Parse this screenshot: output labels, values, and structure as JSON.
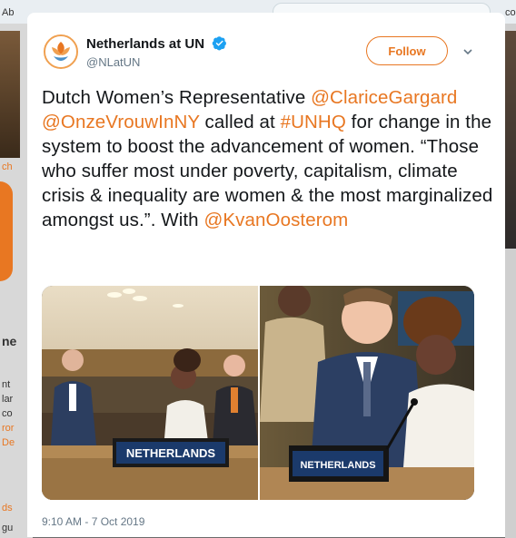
{
  "background": {
    "search_text": "",
    "side_text": [
      "Ab",
      "co",
      "ch",
      "ne",
      "nt",
      "lar",
      "co",
      "ror",
      "De",
      "ds",
      "gu"
    ]
  },
  "tweet": {
    "display_name": "Netherlands at UN",
    "handle": "@NLatUN",
    "follow_label": "Follow",
    "text_parts": [
      {
        "text": "Dutch Women’s Representative ",
        "link": false
      },
      {
        "text": "@ClariceGargard",
        "link": true
      },
      {
        "text": " ",
        "link": false
      },
      {
        "text": "@OnzeVrouwInNY",
        "link": true
      },
      {
        "text": " called at ",
        "link": false
      },
      {
        "text": "#UNHQ",
        "link": true
      },
      {
        "text": " for change in the system to boost the advancement of women. “Those who suffer most under poverty, capitalism, climate crisis & inequality are women & the most marginalized amongst us.”. With ",
        "link": false
      },
      {
        "text": "@KvanOosterom",
        "link": true
      }
    ],
    "media": [
      {
        "nameplate": "NETHERLANDS"
      },
      {
        "nameplate": "NETHERLANDS"
      }
    ],
    "timestamp": "9:10 AM - 7 Oct 2019"
  },
  "colors": {
    "accent": "#e87722",
    "text": "#14171a",
    "muted": "#657786",
    "verified": "#1da1f2"
  },
  "icons": [
    "un-flower-logo-icon",
    "verified-badge-icon",
    "chevron-down-icon"
  ]
}
